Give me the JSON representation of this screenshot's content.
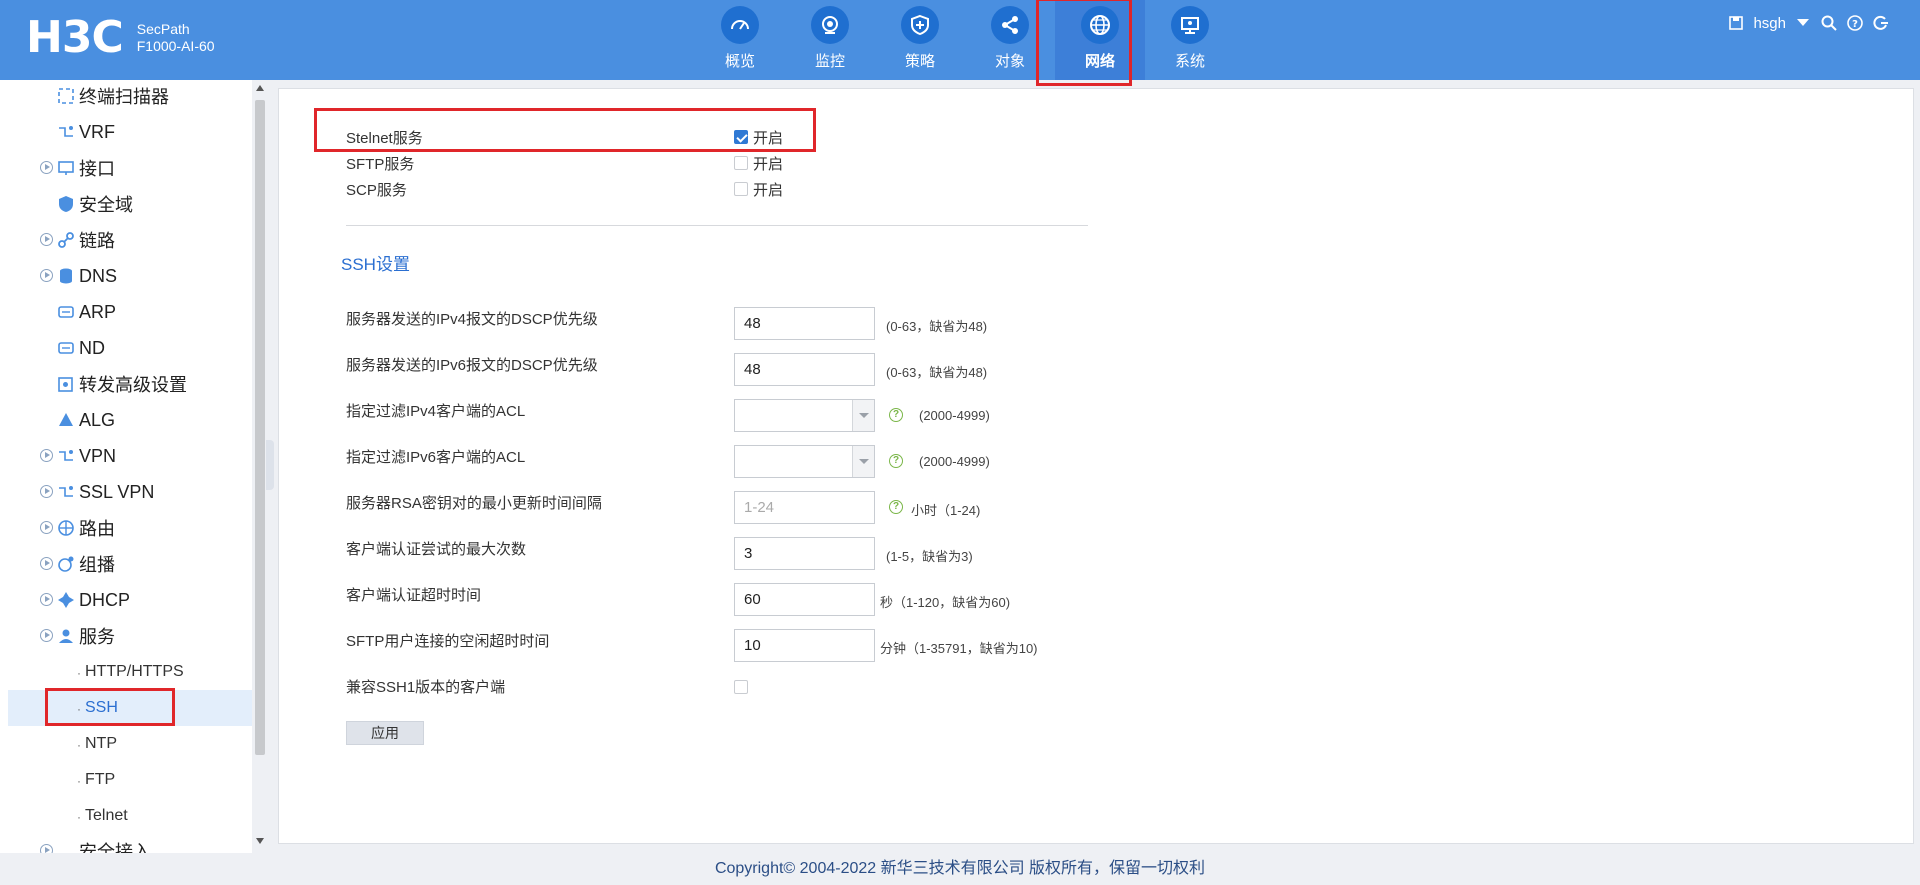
{
  "brand": {
    "logo": "H3C",
    "product_line1": "SecPath",
    "product_line2": "F1000-AI-60"
  },
  "nav": [
    {
      "label": "概览",
      "icon": "gauge-icon"
    },
    {
      "label": "监控",
      "icon": "camera-icon"
    },
    {
      "label": "策略",
      "icon": "shield-icon"
    },
    {
      "label": "对象",
      "icon": "share-icon"
    },
    {
      "label": "网络",
      "icon": "globe-icon",
      "active": true
    },
    {
      "label": "系统",
      "icon": "monitor-icon"
    }
  ],
  "user": {
    "name": "hsgh"
  },
  "sidebar": {
    "items": [
      {
        "label": "终端扫描器",
        "icon": "scan-icon"
      },
      {
        "label": "VRF",
        "icon": "vrf-icon"
      },
      {
        "label": "接口",
        "icon": "interface-icon",
        "expandable": true
      },
      {
        "label": "安全域",
        "icon": "security-zone-icon"
      },
      {
        "label": "链路",
        "icon": "link-icon",
        "expandable": true
      },
      {
        "label": "DNS",
        "icon": "database-icon",
        "expandable": true
      },
      {
        "label": "ARP",
        "icon": "arp-icon"
      },
      {
        "label": "ND",
        "icon": "nd-icon"
      },
      {
        "label": "转发高级设置",
        "icon": "settings-icon"
      },
      {
        "label": "ALG",
        "icon": "alg-icon"
      },
      {
        "label": "VPN",
        "icon": "vpn-icon",
        "expandable": true
      },
      {
        "label": "SSL VPN",
        "icon": "sslvpn-icon",
        "expandable": true
      },
      {
        "label": "路由",
        "icon": "route-icon",
        "expandable": true
      },
      {
        "label": "组播",
        "icon": "multicast-icon",
        "expandable": true
      },
      {
        "label": "DHCP",
        "icon": "dhcp-icon",
        "expandable": true
      },
      {
        "label": "服务",
        "icon": "service-icon",
        "expandable": true
      }
    ],
    "sub_items": [
      {
        "label": "HTTP/HTTPS"
      },
      {
        "label": "SSH",
        "active": true
      },
      {
        "label": "NTP"
      },
      {
        "label": "FTP"
      },
      {
        "label": "Telnet"
      }
    ],
    "next_item": "安全接入"
  },
  "services": {
    "stelnet": {
      "label": "Stelnet服务",
      "option": "开启",
      "checked": true
    },
    "sftp": {
      "label": "SFTP服务",
      "option": "开启",
      "checked": false
    },
    "scp": {
      "label": "SCP服务",
      "option": "开启",
      "checked": false
    }
  },
  "ssh_settings": {
    "title": "SSH设置",
    "rows": [
      {
        "label": "服务器发送的IPv4报文的DSCP优先级",
        "value": "48",
        "hint": "(0-63，缺省为48)"
      },
      {
        "label": "服务器发送的IPv6报文的DSCP优先级",
        "value": "48",
        "hint": "(0-63，缺省为48)"
      },
      {
        "label": "指定过滤IPv4客户端的ACL",
        "value": "",
        "hint": "(2000-4999)"
      },
      {
        "label": "指定过滤IPv6客户端的ACL",
        "value": "",
        "hint": "(2000-4999)"
      },
      {
        "label": "服务器RSA密钥对的最小更新时间间隔",
        "placeholder": "1-24",
        "hint": "小时（1-24)"
      },
      {
        "label": "客户端认证尝试的最大次数",
        "value": "3",
        "hint": "(1-5，缺省为3)"
      },
      {
        "label": "客户端认证超时时间",
        "value": "60",
        "hint": "秒（1-120，缺省为60)"
      },
      {
        "label": "SFTP用户连接的空闲超时时间",
        "value": "10",
        "hint": "分钟（1-35791，缺省为10)"
      },
      {
        "label": "兼容SSH1版本的客户端",
        "checked": false
      }
    ],
    "apply_label": "应用"
  },
  "footer": {
    "text": "Copyright© 2004-2022 新华三技术有限公司 版权所有，保留一切权利"
  }
}
